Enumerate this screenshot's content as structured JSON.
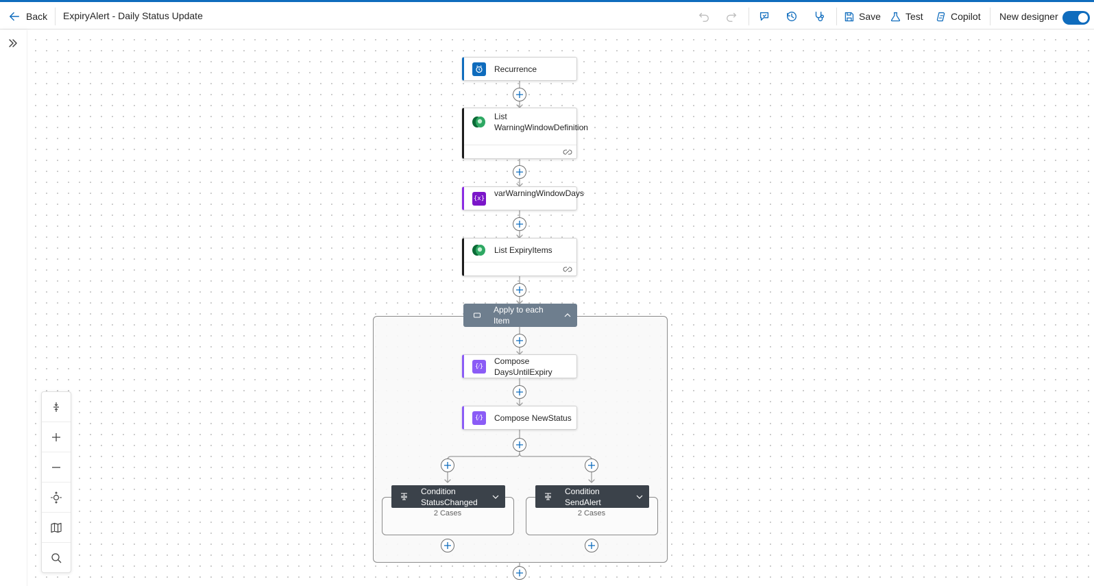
{
  "header": {
    "back_label": "Back",
    "flow_title": "ExpiryAlert - Daily Status Update",
    "save_label": "Save",
    "test_label": "Test",
    "copilot_label": "Copilot",
    "new_designer_label": "New designer",
    "new_designer_enabled": true
  },
  "colors": {
    "accent": "#0f6cbd",
    "dataverse": "#107c41",
    "variable": "#8a2be2",
    "compose": "#8b5cf6",
    "scope_head": "#6e7e8e",
    "condition_head": "#3b424a"
  },
  "nodes": {
    "recurrence": {
      "label": "Recurrence",
      "icon": "clock-icon"
    },
    "list_warning": {
      "label": "List WarningWindowDefinition",
      "icon": "dataverse-icon"
    },
    "var_warning": {
      "label": "varWarningWindowDays",
      "icon": "variable-icon"
    },
    "list_expiry": {
      "label": "List ExpiryItems",
      "icon": "dataverse-icon"
    },
    "apply_each": {
      "label": "Apply to each Item",
      "icon": "loop-icon"
    },
    "compose_days": {
      "label": "Compose DaysUntilExpiry",
      "icon": "compose-icon"
    },
    "compose_status": {
      "label": "Compose NewStatus",
      "icon": "compose-icon"
    },
    "cond_status": {
      "label": "Condition StatusChanged",
      "cases": "2 Cases",
      "icon": "condition-icon"
    },
    "cond_alert": {
      "label": "Condition SendAlert",
      "cases": "2 Cases",
      "icon": "condition-icon"
    }
  },
  "toolbox": [
    "fit-vertical-icon",
    "zoom-in-icon",
    "zoom-out-icon",
    "fit-view-icon",
    "minimap-icon",
    "search-icon"
  ]
}
